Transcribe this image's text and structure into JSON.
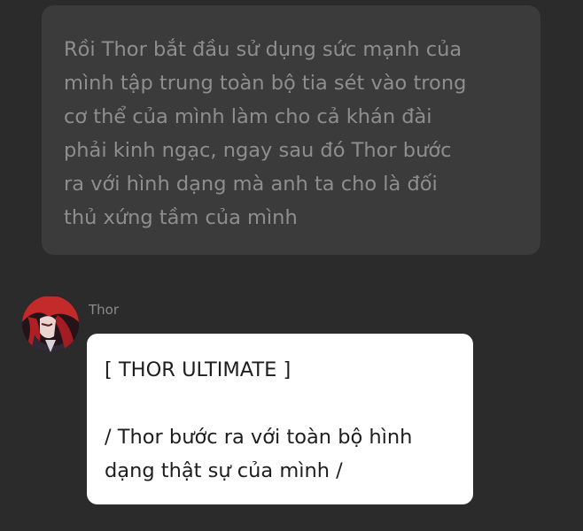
{
  "narration": {
    "text": "Rồi Thor bắt đầu sử dụng sức mạnh của\nmình tập trung toàn bộ tia sét vào trong\ncơ thể của mình làm cho cả khán đài\nphải kinh ngạc, ngay sau đó Thor bước\nra với hình dạng mà anh ta cho là đối\nthủ xứng tầm của mình"
  },
  "message": {
    "avatar_icon": "red-haired-character-avatar",
    "speaker": "Thor",
    "lines": [
      "[ THOR ULTIMATE ]",
      "/ Thor bước ra với toàn bộ hình",
      "dạng thật sự của mình /"
    ]
  },
  "colors": {
    "background": "#2b2b2b",
    "narration_bubble": "#3b3b3b",
    "narration_text": "#8e8e8e",
    "message_bubble": "#ffffff",
    "message_text": "#1e1e1e"
  }
}
